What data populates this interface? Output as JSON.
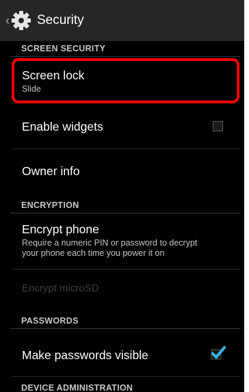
{
  "app_bar": {
    "up_icon": "chevron-left-icon",
    "app_icon": "gear-icon",
    "title": "Security"
  },
  "sections": {
    "screen_security": "SCREEN SECURITY",
    "encryption": "ENCRYPTION",
    "passwords": "PASSWORDS",
    "device_administration": "DEVICE ADMINISTRATION"
  },
  "items": {
    "screen_lock": {
      "title": "Screen lock",
      "summary": "Slide"
    },
    "enable_widgets": {
      "title": "Enable widgets",
      "checked": false
    },
    "owner_info": {
      "title": "Owner info"
    },
    "encrypt_phone": {
      "title": "Encrypt phone",
      "summary_line1": "Require a numeric PIN or password to decrypt",
      "summary_line2": "your phone each time you power it on"
    },
    "encrypt_microsd": {
      "title": "Encrypt microSD",
      "enabled": false
    },
    "make_passwords_visible": {
      "title": "Make passwords visible",
      "checked": true
    }
  },
  "colors": {
    "background": "#000000",
    "action_bar": "#262626",
    "accent_check": "#33b5e5",
    "highlight": "#ff0000"
  }
}
